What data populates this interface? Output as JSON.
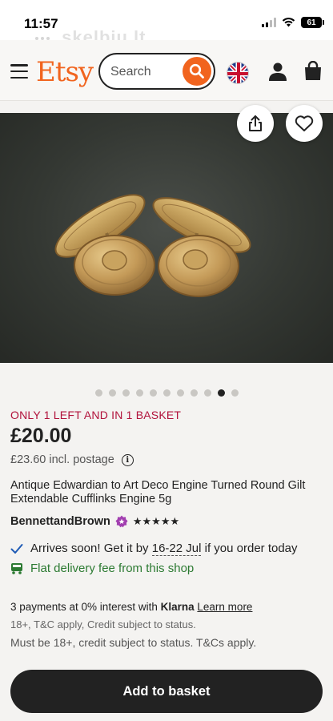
{
  "status_bar": {
    "time": "11:57",
    "battery": "61"
  },
  "watermark": "skelbiu.lt",
  "header": {
    "logo": "Etsy",
    "search_placeholder": "Search",
    "flag_icon": "uk-flag-icon",
    "user_icon": "user-icon",
    "bag_icon": "shopping-bag-icon",
    "accent_color": "#f1641e"
  },
  "gallery": {
    "image_count": 11,
    "active_index": 9
  },
  "product": {
    "stock_notice": "ONLY 1 LEFT AND IN 1 BASKET",
    "price": "£20.00",
    "postage_price": "£23.60 incl. postage",
    "title": "Antique Edwardian to Art Deco Engine Turned Round Gilt Extendable Cufflinks Engine 5g",
    "shop_name": "BennettandBrown",
    "rating": 5
  },
  "delivery": {
    "arrives_prefix": "Arrives soon! Get it by",
    "dates": "16-22 Jul",
    "arrives_suffix": "if you order today",
    "flat_fee": "Flat delivery fee from this shop"
  },
  "payments": {
    "prefix": "3 payments at 0% interest with",
    "brand": "Klarna",
    "learn_more": "Learn more",
    "terms_small": "18+, T&C apply, Credit subject to status.",
    "terms": "Must be 18+, credit subject to status. T&Cs apply."
  },
  "cta": {
    "add_to_basket": "Add to basket"
  }
}
